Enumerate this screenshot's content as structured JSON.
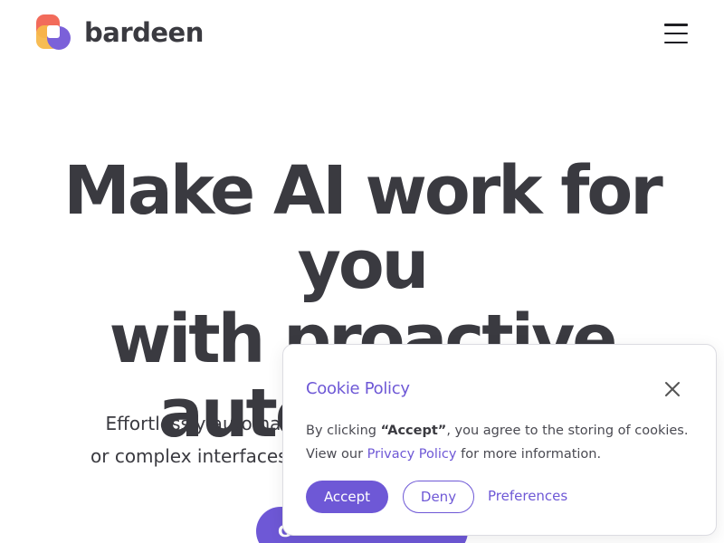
{
  "header": {
    "brand": "bardeen",
    "logo_icon": "bardeen-logo",
    "menu_icon": "hamburger-menu-icon"
  },
  "hero": {
    "title_lines": [
      "Make AI work for you",
      "with proactive",
      "automation"
    ],
    "subtitle_lines": [
      "Effortlessly automate tasks",
      "or complex interfaces"
    ],
    "cta_label": "G"
  },
  "cookie": {
    "title": "Cookie Policy",
    "close_icon": "close-icon",
    "text_prefix": "By clicking ",
    "text_bold": "“Accept”",
    "text_suffix": ", you agree to the storing of cookies.",
    "text_line2_prefix": "View our ",
    "privacy_link": "Privacy Policy",
    "text_line2_suffix": " for more information.",
    "accept_label": "Accept",
    "deny_label": "Deny",
    "preferences_label": "Preferences"
  },
  "colors": {
    "accent": "#6e58d6",
    "text": "#3a3a40",
    "background": "#ffffff"
  }
}
